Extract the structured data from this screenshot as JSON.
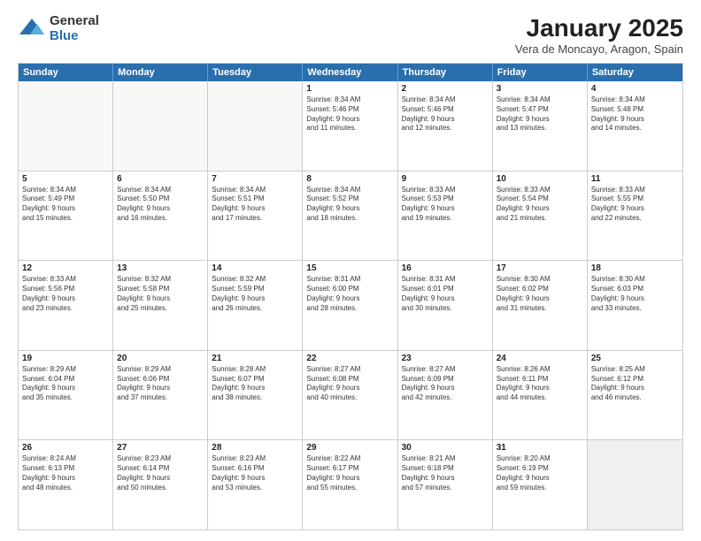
{
  "logo": {
    "general": "General",
    "blue": "Blue"
  },
  "title": {
    "month": "January 2025",
    "location": "Vera de Moncayo, Aragon, Spain"
  },
  "days": [
    "Sunday",
    "Monday",
    "Tuesday",
    "Wednesday",
    "Thursday",
    "Friday",
    "Saturday"
  ],
  "rows": [
    [
      {
        "day": "",
        "empty": true
      },
      {
        "day": "",
        "empty": true
      },
      {
        "day": "",
        "empty": true
      },
      {
        "day": "1",
        "lines": [
          "Sunrise: 8:34 AM",
          "Sunset: 5:46 PM",
          "Daylight: 9 hours",
          "and 11 minutes."
        ]
      },
      {
        "day": "2",
        "lines": [
          "Sunrise: 8:34 AM",
          "Sunset: 5:46 PM",
          "Daylight: 9 hours",
          "and 12 minutes."
        ]
      },
      {
        "day": "3",
        "lines": [
          "Sunrise: 8:34 AM",
          "Sunset: 5:47 PM",
          "Daylight: 9 hours",
          "and 13 minutes."
        ]
      },
      {
        "day": "4",
        "lines": [
          "Sunrise: 8:34 AM",
          "Sunset: 5:48 PM",
          "Daylight: 9 hours",
          "and 14 minutes."
        ]
      }
    ],
    [
      {
        "day": "5",
        "lines": [
          "Sunrise: 8:34 AM",
          "Sunset: 5:49 PM",
          "Daylight: 9 hours",
          "and 15 minutes."
        ]
      },
      {
        "day": "6",
        "lines": [
          "Sunrise: 8:34 AM",
          "Sunset: 5:50 PM",
          "Daylight: 9 hours",
          "and 16 minutes."
        ]
      },
      {
        "day": "7",
        "lines": [
          "Sunrise: 8:34 AM",
          "Sunset: 5:51 PM",
          "Daylight: 9 hours",
          "and 17 minutes."
        ]
      },
      {
        "day": "8",
        "lines": [
          "Sunrise: 8:34 AM",
          "Sunset: 5:52 PM",
          "Daylight: 9 hours",
          "and 18 minutes."
        ]
      },
      {
        "day": "9",
        "lines": [
          "Sunrise: 8:33 AM",
          "Sunset: 5:53 PM",
          "Daylight: 9 hours",
          "and 19 minutes."
        ]
      },
      {
        "day": "10",
        "lines": [
          "Sunrise: 8:33 AM",
          "Sunset: 5:54 PM",
          "Daylight: 9 hours",
          "and 21 minutes."
        ]
      },
      {
        "day": "11",
        "lines": [
          "Sunrise: 8:33 AM",
          "Sunset: 5:55 PM",
          "Daylight: 9 hours",
          "and 22 minutes."
        ]
      }
    ],
    [
      {
        "day": "12",
        "lines": [
          "Sunrise: 8:33 AM",
          "Sunset: 5:56 PM",
          "Daylight: 9 hours",
          "and 23 minutes."
        ]
      },
      {
        "day": "13",
        "lines": [
          "Sunrise: 8:32 AM",
          "Sunset: 5:58 PM",
          "Daylight: 9 hours",
          "and 25 minutes."
        ]
      },
      {
        "day": "14",
        "lines": [
          "Sunrise: 8:32 AM",
          "Sunset: 5:59 PM",
          "Daylight: 9 hours",
          "and 26 minutes."
        ]
      },
      {
        "day": "15",
        "lines": [
          "Sunrise: 8:31 AM",
          "Sunset: 6:00 PM",
          "Daylight: 9 hours",
          "and 28 minutes."
        ]
      },
      {
        "day": "16",
        "lines": [
          "Sunrise: 8:31 AM",
          "Sunset: 6:01 PM",
          "Daylight: 9 hours",
          "and 30 minutes."
        ]
      },
      {
        "day": "17",
        "lines": [
          "Sunrise: 8:30 AM",
          "Sunset: 6:02 PM",
          "Daylight: 9 hours",
          "and 31 minutes."
        ]
      },
      {
        "day": "18",
        "lines": [
          "Sunrise: 8:30 AM",
          "Sunset: 6:03 PM",
          "Daylight: 9 hours",
          "and 33 minutes."
        ]
      }
    ],
    [
      {
        "day": "19",
        "lines": [
          "Sunrise: 8:29 AM",
          "Sunset: 6:04 PM",
          "Daylight: 9 hours",
          "and 35 minutes."
        ]
      },
      {
        "day": "20",
        "lines": [
          "Sunrise: 8:29 AM",
          "Sunset: 6:06 PM",
          "Daylight: 9 hours",
          "and 37 minutes."
        ]
      },
      {
        "day": "21",
        "lines": [
          "Sunrise: 8:28 AM",
          "Sunset: 6:07 PM",
          "Daylight: 9 hours",
          "and 38 minutes."
        ]
      },
      {
        "day": "22",
        "lines": [
          "Sunrise: 8:27 AM",
          "Sunset: 6:08 PM",
          "Daylight: 9 hours",
          "and 40 minutes."
        ]
      },
      {
        "day": "23",
        "lines": [
          "Sunrise: 8:27 AM",
          "Sunset: 6:09 PM",
          "Daylight: 9 hours",
          "and 42 minutes."
        ]
      },
      {
        "day": "24",
        "lines": [
          "Sunrise: 8:26 AM",
          "Sunset: 6:11 PM",
          "Daylight: 9 hours",
          "and 44 minutes."
        ]
      },
      {
        "day": "25",
        "lines": [
          "Sunrise: 8:25 AM",
          "Sunset: 6:12 PM",
          "Daylight: 9 hours",
          "and 46 minutes."
        ]
      }
    ],
    [
      {
        "day": "26",
        "lines": [
          "Sunrise: 8:24 AM",
          "Sunset: 6:13 PM",
          "Daylight: 9 hours",
          "and 48 minutes."
        ]
      },
      {
        "day": "27",
        "lines": [
          "Sunrise: 8:23 AM",
          "Sunset: 6:14 PM",
          "Daylight: 9 hours",
          "and 50 minutes."
        ]
      },
      {
        "day": "28",
        "lines": [
          "Sunrise: 8:23 AM",
          "Sunset: 6:16 PM",
          "Daylight: 9 hours",
          "and 53 minutes."
        ]
      },
      {
        "day": "29",
        "lines": [
          "Sunrise: 8:22 AM",
          "Sunset: 6:17 PM",
          "Daylight: 9 hours",
          "and 55 minutes."
        ]
      },
      {
        "day": "30",
        "lines": [
          "Sunrise: 8:21 AM",
          "Sunset: 6:18 PM",
          "Daylight: 9 hours",
          "and 57 minutes."
        ]
      },
      {
        "day": "31",
        "lines": [
          "Sunrise: 8:20 AM",
          "Sunset: 6:19 PM",
          "Daylight: 9 hours",
          "and 59 minutes."
        ]
      },
      {
        "day": "",
        "empty": true,
        "shaded": true
      }
    ]
  ]
}
